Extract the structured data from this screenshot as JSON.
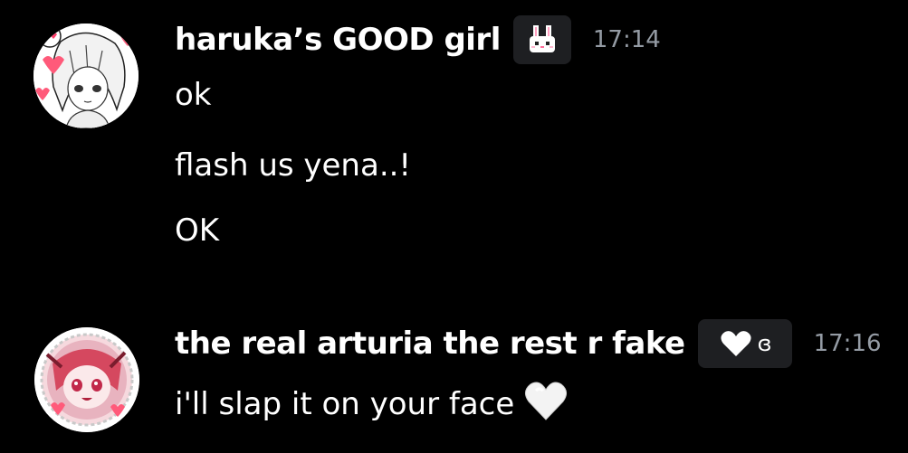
{
  "messages": [
    {
      "author": "haruka’s GOOD girl",
      "tag_icon": "bunny-icon",
      "time": "17:14",
      "lines": [
        "ok",
        "flash us yena..!",
        "OK"
      ]
    },
    {
      "author": "the real arturia the rest r fake",
      "tag_icon": "white-heart-icon",
      "tag_text": "ɞ",
      "time": "17:16",
      "lines": [
        "i'll slap it on your face"
      ],
      "trailing_emoji": "white-heart-emoji"
    }
  ],
  "colors": {
    "background": "#000000",
    "text": "#ffffff",
    "timestamp": "#949ba4",
    "tag_background": "#1e1f22",
    "heart_accent": "#ff5a7a"
  }
}
